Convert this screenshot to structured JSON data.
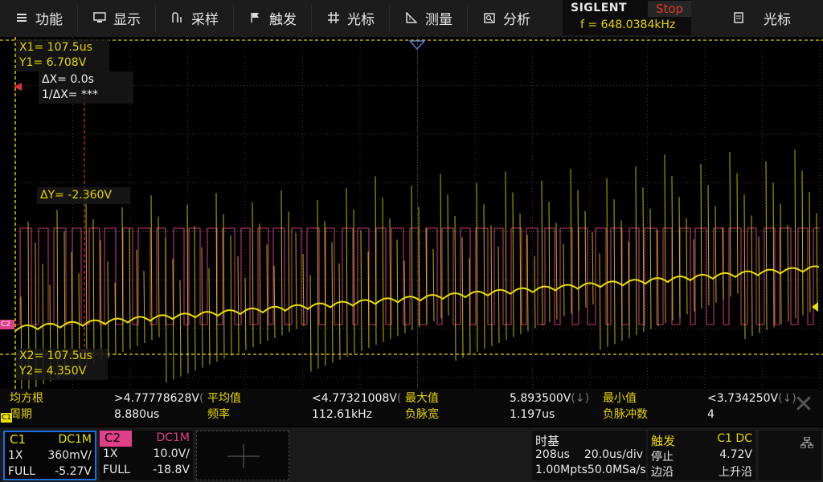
{
  "menu": [
    {
      "label": "功能",
      "icon": "menu-icon"
    },
    {
      "label": "显示",
      "icon": "display-icon"
    },
    {
      "label": "采样",
      "icon": "acquire-icon"
    },
    {
      "label": "触发",
      "icon": "trigger-flag-icon"
    },
    {
      "label": "光标",
      "icon": "cursor-grid-icon"
    },
    {
      "label": "测量",
      "icon": "measure-icon"
    },
    {
      "label": "分析",
      "icon": "analysis-icon"
    }
  ],
  "brand": {
    "name": "SIGLENT",
    "run_state": "Stop",
    "frequency": "f = 648.0384kHz"
  },
  "right_menu": {
    "label": "光标",
    "icon": "cursor-doc-icon"
  },
  "cursor": {
    "x1": "X1= 107.5us",
    "y1": "Y1= 6.708V",
    "dx": "ΔX= 0.0s",
    "inv_dx": "1/ΔX= ***",
    "dy": "ΔY= -2.360V",
    "x2": "X2= 107.5us",
    "y2": "Y2= 4.350V",
    "marker_y2": "X2",
    "marker_c2": "C2"
  },
  "measurements": {
    "row1": [
      {
        "label": "均方根",
        "value": ">4.77778628V"
      },
      {
        "label": "平均值",
        "value": "<4.77321008V"
      },
      {
        "label": "最大值",
        "value": "5.893500V"
      },
      {
        "label": "最小值",
        "value": "<3.734250V"
      }
    ],
    "row2": [
      {
        "label": "周期",
        "value": "8.880us"
      },
      {
        "label": "频率",
        "value": "112.61kHz"
      },
      {
        "label": "负脉宽",
        "value": "1.197us"
      },
      {
        "label": "负脉冲数",
        "value": "4"
      }
    ],
    "row1_suffix": [
      "(",
      "(",
      "(↓)",
      "(↓)"
    ],
    "tag": "C1"
  },
  "channels": {
    "c1": {
      "name": "C1",
      "coupling": "DC1M",
      "probe": "1X",
      "scale": "360mV/",
      "bw": "FULL",
      "offset": "-5.27V"
    },
    "c2": {
      "name": "C2",
      "coupling": "DC1M",
      "probe": "1X",
      "scale": "10.0V/",
      "bw": "FULL",
      "offset": "-18.8V"
    }
  },
  "timebase": {
    "title": "时基",
    "delay": "208us",
    "scale": "20.0us/div",
    "depth": "1.00Mpts",
    "rate": "50.0MSa/s"
  },
  "trigger": {
    "title": "触发",
    "source": "C1 DC",
    "level": "4.72V",
    "state": "停止",
    "type": "边沿",
    "slope": "上升沿"
  },
  "colors": {
    "c1": "#e8e000",
    "c2": "#e0408a",
    "grid": "#3a3a3a",
    "cursor": "#e8d400",
    "cursor_v": "#e03030"
  }
}
